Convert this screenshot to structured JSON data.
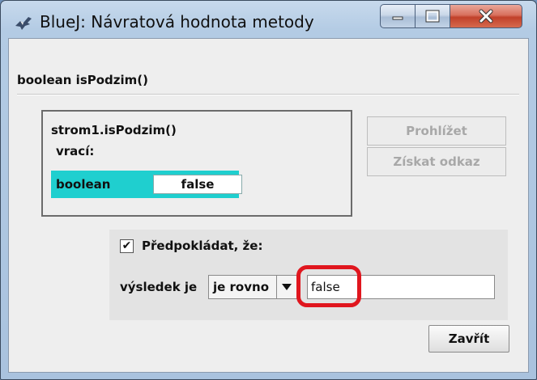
{
  "window": {
    "title": "BlueJ:  Návratová hodnota metody"
  },
  "dialog": {
    "header": "boolean isPodzim()",
    "call": "strom1.isPodzim()",
    "returns_label": "vrací:",
    "result_type": "boolean",
    "result_value": "false",
    "inspect_label": "Prohlížet",
    "get_reference_label": "Získat odkaz",
    "close_label": "Zavřít"
  },
  "assert": {
    "checkbox_mark": "✔",
    "assume_label": "Předpokládat, že:",
    "result_label": "výsledek je",
    "comparison_selected": "je rovno",
    "expected_value": "false"
  },
  "colors": {
    "result_row_bg": "#1fcfcf",
    "highlight_border": "#e0161e",
    "close_button_red": "#c1412a"
  },
  "icons": {
    "app": "bluej-bird-icon",
    "minimize": "minimize-icon",
    "maximize": "maximize-icon",
    "close": "close-icon",
    "dropdown": "triangle-down-icon"
  }
}
